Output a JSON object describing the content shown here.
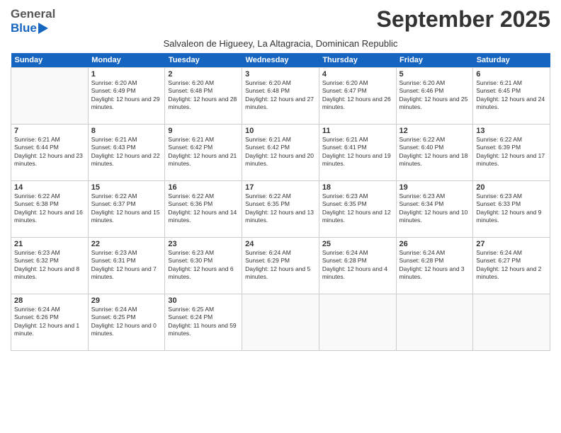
{
  "header": {
    "logo_general": "General",
    "logo_blue": "Blue",
    "month": "September 2025",
    "subtitle": "Salvaleon de Higueey, La Altagracia, Dominican Republic"
  },
  "days_of_week": [
    "Sunday",
    "Monday",
    "Tuesday",
    "Wednesday",
    "Thursday",
    "Friday",
    "Saturday"
  ],
  "weeks": [
    [
      {
        "day": "",
        "sunrise": "",
        "sunset": "",
        "daylight": ""
      },
      {
        "day": "1",
        "sunrise": "6:20 AM",
        "sunset": "6:49 PM",
        "daylight": "12 hours and 29 minutes."
      },
      {
        "day": "2",
        "sunrise": "6:20 AM",
        "sunset": "6:48 PM",
        "daylight": "12 hours and 28 minutes."
      },
      {
        "day": "3",
        "sunrise": "6:20 AM",
        "sunset": "6:48 PM",
        "daylight": "12 hours and 27 minutes."
      },
      {
        "day": "4",
        "sunrise": "6:20 AM",
        "sunset": "6:47 PM",
        "daylight": "12 hours and 26 minutes."
      },
      {
        "day": "5",
        "sunrise": "6:20 AM",
        "sunset": "6:46 PM",
        "daylight": "12 hours and 25 minutes."
      },
      {
        "day": "6",
        "sunrise": "6:21 AM",
        "sunset": "6:45 PM",
        "daylight": "12 hours and 24 minutes."
      }
    ],
    [
      {
        "day": "7",
        "sunrise": "6:21 AM",
        "sunset": "6:44 PM",
        "daylight": "12 hours and 23 minutes."
      },
      {
        "day": "8",
        "sunrise": "6:21 AM",
        "sunset": "6:43 PM",
        "daylight": "12 hours and 22 minutes."
      },
      {
        "day": "9",
        "sunrise": "6:21 AM",
        "sunset": "6:42 PM",
        "daylight": "12 hours and 21 minutes."
      },
      {
        "day": "10",
        "sunrise": "6:21 AM",
        "sunset": "6:42 PM",
        "daylight": "12 hours and 20 minutes."
      },
      {
        "day": "11",
        "sunrise": "6:21 AM",
        "sunset": "6:41 PM",
        "daylight": "12 hours and 19 minutes."
      },
      {
        "day": "12",
        "sunrise": "6:22 AM",
        "sunset": "6:40 PM",
        "daylight": "12 hours and 18 minutes."
      },
      {
        "day": "13",
        "sunrise": "6:22 AM",
        "sunset": "6:39 PM",
        "daylight": "12 hours and 17 minutes."
      }
    ],
    [
      {
        "day": "14",
        "sunrise": "6:22 AM",
        "sunset": "6:38 PM",
        "daylight": "12 hours and 16 minutes."
      },
      {
        "day": "15",
        "sunrise": "6:22 AM",
        "sunset": "6:37 PM",
        "daylight": "12 hours and 15 minutes."
      },
      {
        "day": "16",
        "sunrise": "6:22 AM",
        "sunset": "6:36 PM",
        "daylight": "12 hours and 14 minutes."
      },
      {
        "day": "17",
        "sunrise": "6:22 AM",
        "sunset": "6:35 PM",
        "daylight": "12 hours and 13 minutes."
      },
      {
        "day": "18",
        "sunrise": "6:23 AM",
        "sunset": "6:35 PM",
        "daylight": "12 hours and 12 minutes."
      },
      {
        "day": "19",
        "sunrise": "6:23 AM",
        "sunset": "6:34 PM",
        "daylight": "12 hours and 10 minutes."
      },
      {
        "day": "20",
        "sunrise": "6:23 AM",
        "sunset": "6:33 PM",
        "daylight": "12 hours and 9 minutes."
      }
    ],
    [
      {
        "day": "21",
        "sunrise": "6:23 AM",
        "sunset": "6:32 PM",
        "daylight": "12 hours and 8 minutes."
      },
      {
        "day": "22",
        "sunrise": "6:23 AM",
        "sunset": "6:31 PM",
        "daylight": "12 hours and 7 minutes."
      },
      {
        "day": "23",
        "sunrise": "6:23 AM",
        "sunset": "6:30 PM",
        "daylight": "12 hours and 6 minutes."
      },
      {
        "day": "24",
        "sunrise": "6:24 AM",
        "sunset": "6:29 PM",
        "daylight": "12 hours and 5 minutes."
      },
      {
        "day": "25",
        "sunrise": "6:24 AM",
        "sunset": "6:28 PM",
        "daylight": "12 hours and 4 minutes."
      },
      {
        "day": "26",
        "sunrise": "6:24 AM",
        "sunset": "6:28 PM",
        "daylight": "12 hours and 3 minutes."
      },
      {
        "day": "27",
        "sunrise": "6:24 AM",
        "sunset": "6:27 PM",
        "daylight": "12 hours and 2 minutes."
      }
    ],
    [
      {
        "day": "28",
        "sunrise": "6:24 AM",
        "sunset": "6:26 PM",
        "daylight": "12 hours and 1 minute."
      },
      {
        "day": "29",
        "sunrise": "6:24 AM",
        "sunset": "6:25 PM",
        "daylight": "12 hours and 0 minutes."
      },
      {
        "day": "30",
        "sunrise": "6:25 AM",
        "sunset": "6:24 PM",
        "daylight": "11 hours and 59 minutes."
      },
      {
        "day": "",
        "sunrise": "",
        "sunset": "",
        "daylight": ""
      },
      {
        "day": "",
        "sunrise": "",
        "sunset": "",
        "daylight": ""
      },
      {
        "day": "",
        "sunrise": "",
        "sunset": "",
        "daylight": ""
      },
      {
        "day": "",
        "sunrise": "",
        "sunset": "",
        "daylight": ""
      }
    ]
  ]
}
